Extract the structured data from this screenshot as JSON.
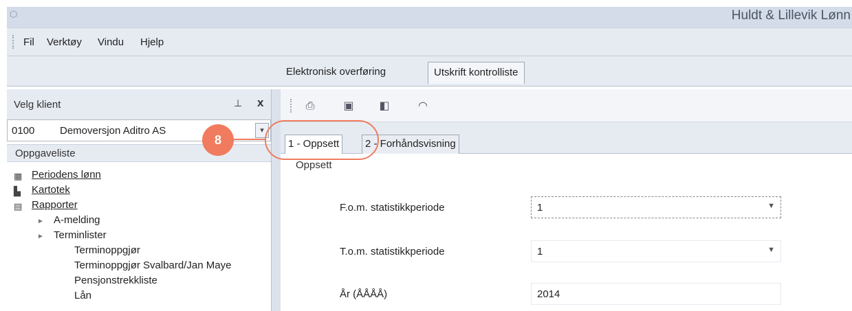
{
  "window": {
    "title": "Huldt & Lillevik Lønn",
    "app_icon": "app-icon"
  },
  "menu": {
    "items": [
      "Fil",
      "Verktøy",
      "Vindu",
      "Hjelp"
    ]
  },
  "top_tabs": [
    {
      "label": "Elektronisk overføring",
      "active": false
    },
    {
      "label": "Utskrift kontrolliste",
      "active": true
    }
  ],
  "left_panel": {
    "header": "Velg klient",
    "pin_icon": "pin-icon",
    "close_label": "x",
    "client": {
      "code": "0100",
      "name": "Demoversjon Aditro AS",
      "dropdown_icon": "chevron-down-icon"
    },
    "task_list_header": "Oppgaveliste",
    "tree": [
      {
        "label": "Periodens lønn",
        "icon": "payroll-icon"
      },
      {
        "label": "Kartotek",
        "icon": "folder-icon"
      },
      {
        "label": "Rapporter",
        "icon": "report-icon"
      },
      {
        "label": "A-melding",
        "icon": "expand-arrow-icon"
      },
      {
        "label": "Terminlister",
        "icon": "expand-arrow-icon"
      },
      {
        "label": "Terminoppgjør"
      },
      {
        "label": "Terminoppgjør Svalbard/Jan Maye"
      },
      {
        "label": "Pensjonstrekkliste"
      },
      {
        "label": "Lån"
      }
    ]
  },
  "toolbar": {
    "icons": [
      "print-icon",
      "excel-export-icon",
      "export-icon",
      "email-icon"
    ]
  },
  "sub_tabs": [
    {
      "label": "1 - Oppsett",
      "active": true
    },
    {
      "label": "2 - Forhåndsvisning",
      "active": false
    }
  ],
  "form": {
    "section_title": "Oppsett",
    "from_period": {
      "label": "F.o.m. statistikkperiode",
      "value": "1"
    },
    "to_period": {
      "label": "T.o.m. statistikkperiode",
      "value": "1"
    },
    "year": {
      "label": "År (ÅÅÅÅ)",
      "value": "2014"
    }
  },
  "callout": {
    "number": "8"
  },
  "colors": {
    "accent": "#f07b5e",
    "chrome": "#e6ebf2"
  }
}
